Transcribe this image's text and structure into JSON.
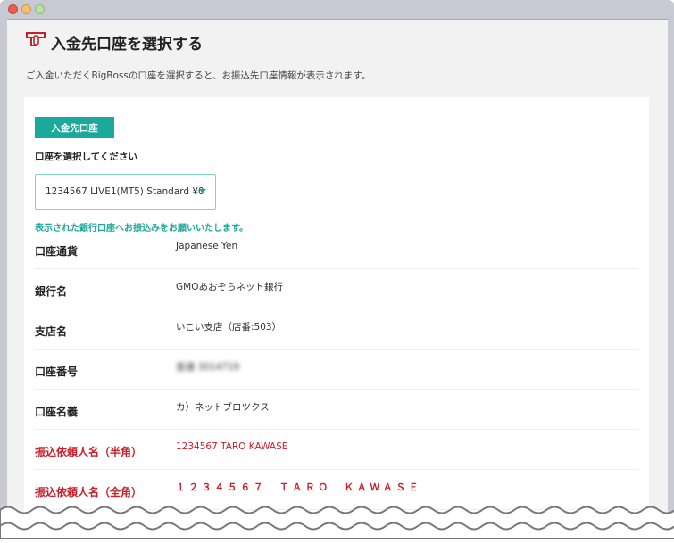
{
  "window": {
    "controls": [
      "close",
      "minimize",
      "maximize"
    ]
  },
  "header": {
    "title": "入金先口座を選択する",
    "icon": "atm-card-icon",
    "description": "ご入金いただくBigBossの口座を選択すると、お振込先口座情報が表示されます。"
  },
  "card": {
    "tab_label": "入金先口座",
    "select_label": "口座を選択してください",
    "selected_account": "1234567 LIVE1(MT5) Standard ¥0",
    "notice": "表示された銀行口座へお振込みをお願いいたします。",
    "rows": [
      {
        "label": "口座通貨",
        "value": "Japanese Yen"
      },
      {
        "label": "銀行名",
        "value": "GMOあおぞらネット銀行"
      },
      {
        "label": "支店名",
        "value": "いこい支店（店番:503）"
      },
      {
        "label": "口座番号",
        "value": "普通 3014719"
      },
      {
        "label": "口座名義",
        "value": "カ）ネットブロツクス"
      },
      {
        "label": "振込依頼人名（半角）",
        "value": "1234567 TARO KAWASE"
      },
      {
        "label": "振込依頼人名（全角）",
        "value": "１２３４５６７　ＴＡＲＯ　ＫＡＷＡＳＥ"
      }
    ]
  },
  "colors": {
    "accent": "#1aa99a",
    "alert": "#c8202a"
  }
}
